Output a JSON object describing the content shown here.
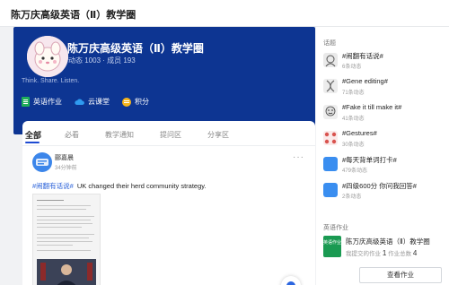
{
  "app": {
    "title": "陈万庆高级英语（Ⅱ）教学圈"
  },
  "hero": {
    "group_name": "陈万庆高级英语（Ⅱ）教学圈",
    "stats": "动态 1003 · 成员 193",
    "slogan": "Think. Share. Listen.",
    "links": [
      {
        "label": "英语作业",
        "icon": "document-icon"
      },
      {
        "label": "云课堂",
        "icon": "cloud-icon"
      },
      {
        "label": "积分",
        "icon": "coin-icon"
      }
    ],
    "colors": {
      "background": "#0d3592",
      "accent": "#2b62d9"
    }
  },
  "tabs": [
    "全部",
    "必看",
    "教学通知",
    "提问区",
    "分享区"
  ],
  "post": {
    "author": "郦嘉晨",
    "time": "34分钟前",
    "more": "···",
    "tag": "#闹翻有话说#",
    "text": "UK changed their herd community strategy."
  },
  "sidebar": {
    "topics_heading": "话题",
    "topics": [
      {
        "name": "#闹翻有话说#",
        "count": "6条动态"
      },
      {
        "name": "#Gene editing#",
        "count": "71条动态"
      },
      {
        "name": "#Fake it till make it#",
        "count": "41条动态"
      },
      {
        "name": "#Gestures#",
        "count": "30条动态"
      },
      {
        "name": "#每天背单词打卡#",
        "count": "479条动态"
      },
      {
        "name": "#四级600分 你问我回答#",
        "count": "2条动态"
      }
    ],
    "homework_heading": "英语作业",
    "homework": {
      "icon_text": "英语作业",
      "name": "陈万庆高级英语（Ⅱ）教学圈",
      "meta_prefix": "我提交的作业",
      "submitted": "1",
      "meta_mid": "作业总数",
      "total": "4",
      "button": "查看作业"
    }
  }
}
